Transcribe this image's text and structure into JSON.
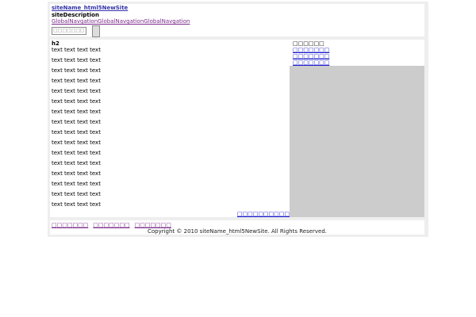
{
  "header": {
    "site_name": "siteName_html5NewSite",
    "site_description": "siteDescription",
    "global_nav": [
      "GlobalNavgation",
      "GlobalNavgation",
      "GlobalNavgation"
    ],
    "search": {
      "placeholder": "□□□□□□□",
      "button_label": ""
    }
  },
  "main": {
    "heading": "h2",
    "paragraphs": [
      "text text text text",
      "text text text text",
      "text text text text",
      "text text text text",
      "text text text text",
      "text text text text",
      "text text text text",
      "text text text text",
      "text text text text",
      "text text text text",
      "text text text text",
      "text text text text",
      "text text text text",
      "text text text text",
      "text text text text",
      "text text text text"
    ],
    "page_top_link": "□□□□□□□□□□"
  },
  "sidebar": {
    "title": "□□□□□□",
    "links": [
      "□□□□□□□",
      "□□□□□□□",
      "□□□□□□□"
    ]
  },
  "footer": {
    "nav": [
      "□□□□□□□",
      "□□□□□□□",
      "□□□□□□□"
    ],
    "copyright": "Copyright © 2010 siteName_html5NewSite. All Rights Reserved."
  }
}
